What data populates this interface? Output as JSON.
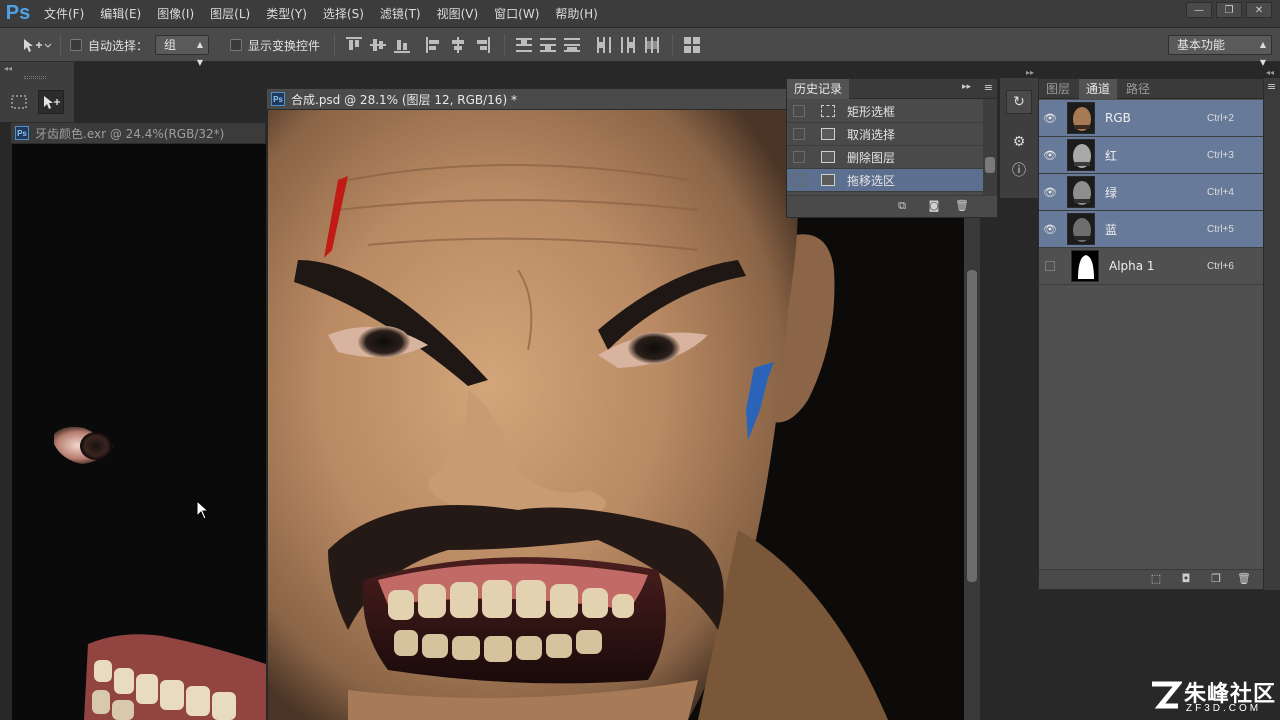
{
  "app": {
    "logo": "Ps"
  },
  "menu": [
    "文件(F)",
    "编辑(E)",
    "图像(I)",
    "图层(L)",
    "类型(Y)",
    "选择(S)",
    "滤镜(T)",
    "视图(V)",
    "窗口(W)",
    "帮助(H)"
  ],
  "window_controls": {
    "minimize": "—",
    "restore": "❐",
    "close": "✕"
  },
  "options": {
    "auto_select_label": "自动选择：",
    "auto_select_value": "组",
    "show_transform_label": "显示变换控件",
    "workspace": "基本功能"
  },
  "documents": [
    {
      "title": "牙齿颜色.exr @ 24.4%(RGB/32*)"
    },
    {
      "title": "合成.psd @ 28.1% (图层 12, RGB/16) *"
    }
  ],
  "history": {
    "tab": "历史记录",
    "items": [
      {
        "label": "矩形选框",
        "icon": "marquee-icon"
      },
      {
        "label": "取消选择",
        "icon": "document-icon"
      },
      {
        "label": "删除图层",
        "icon": "document-icon"
      },
      {
        "label": "拖移选区",
        "icon": "document-icon",
        "selected": true
      }
    ]
  },
  "channels": {
    "tabs": [
      "图层",
      "通道",
      "路径"
    ],
    "active_tab": "通道",
    "items": [
      {
        "name": "RGB",
        "shortcut": "Ctrl+2",
        "visible": true,
        "selected": true
      },
      {
        "name": "红",
        "shortcut": "Ctrl+3",
        "visible": true,
        "selected": true
      },
      {
        "name": "绿",
        "shortcut": "Ctrl+4",
        "visible": true,
        "selected": true
      },
      {
        "name": "蓝",
        "shortcut": "Ctrl+5",
        "visible": true,
        "selected": true
      },
      {
        "name": "Alpha 1",
        "shortcut": "Ctrl+6",
        "visible": false,
        "selected": false
      }
    ]
  },
  "watermark": {
    "main": "朱峰社区",
    "sub": "ZF3D.COM"
  },
  "colors": {
    "selection": "#677a99",
    "ps_blue": "#4ea3e8",
    "panel": "#505050"
  }
}
